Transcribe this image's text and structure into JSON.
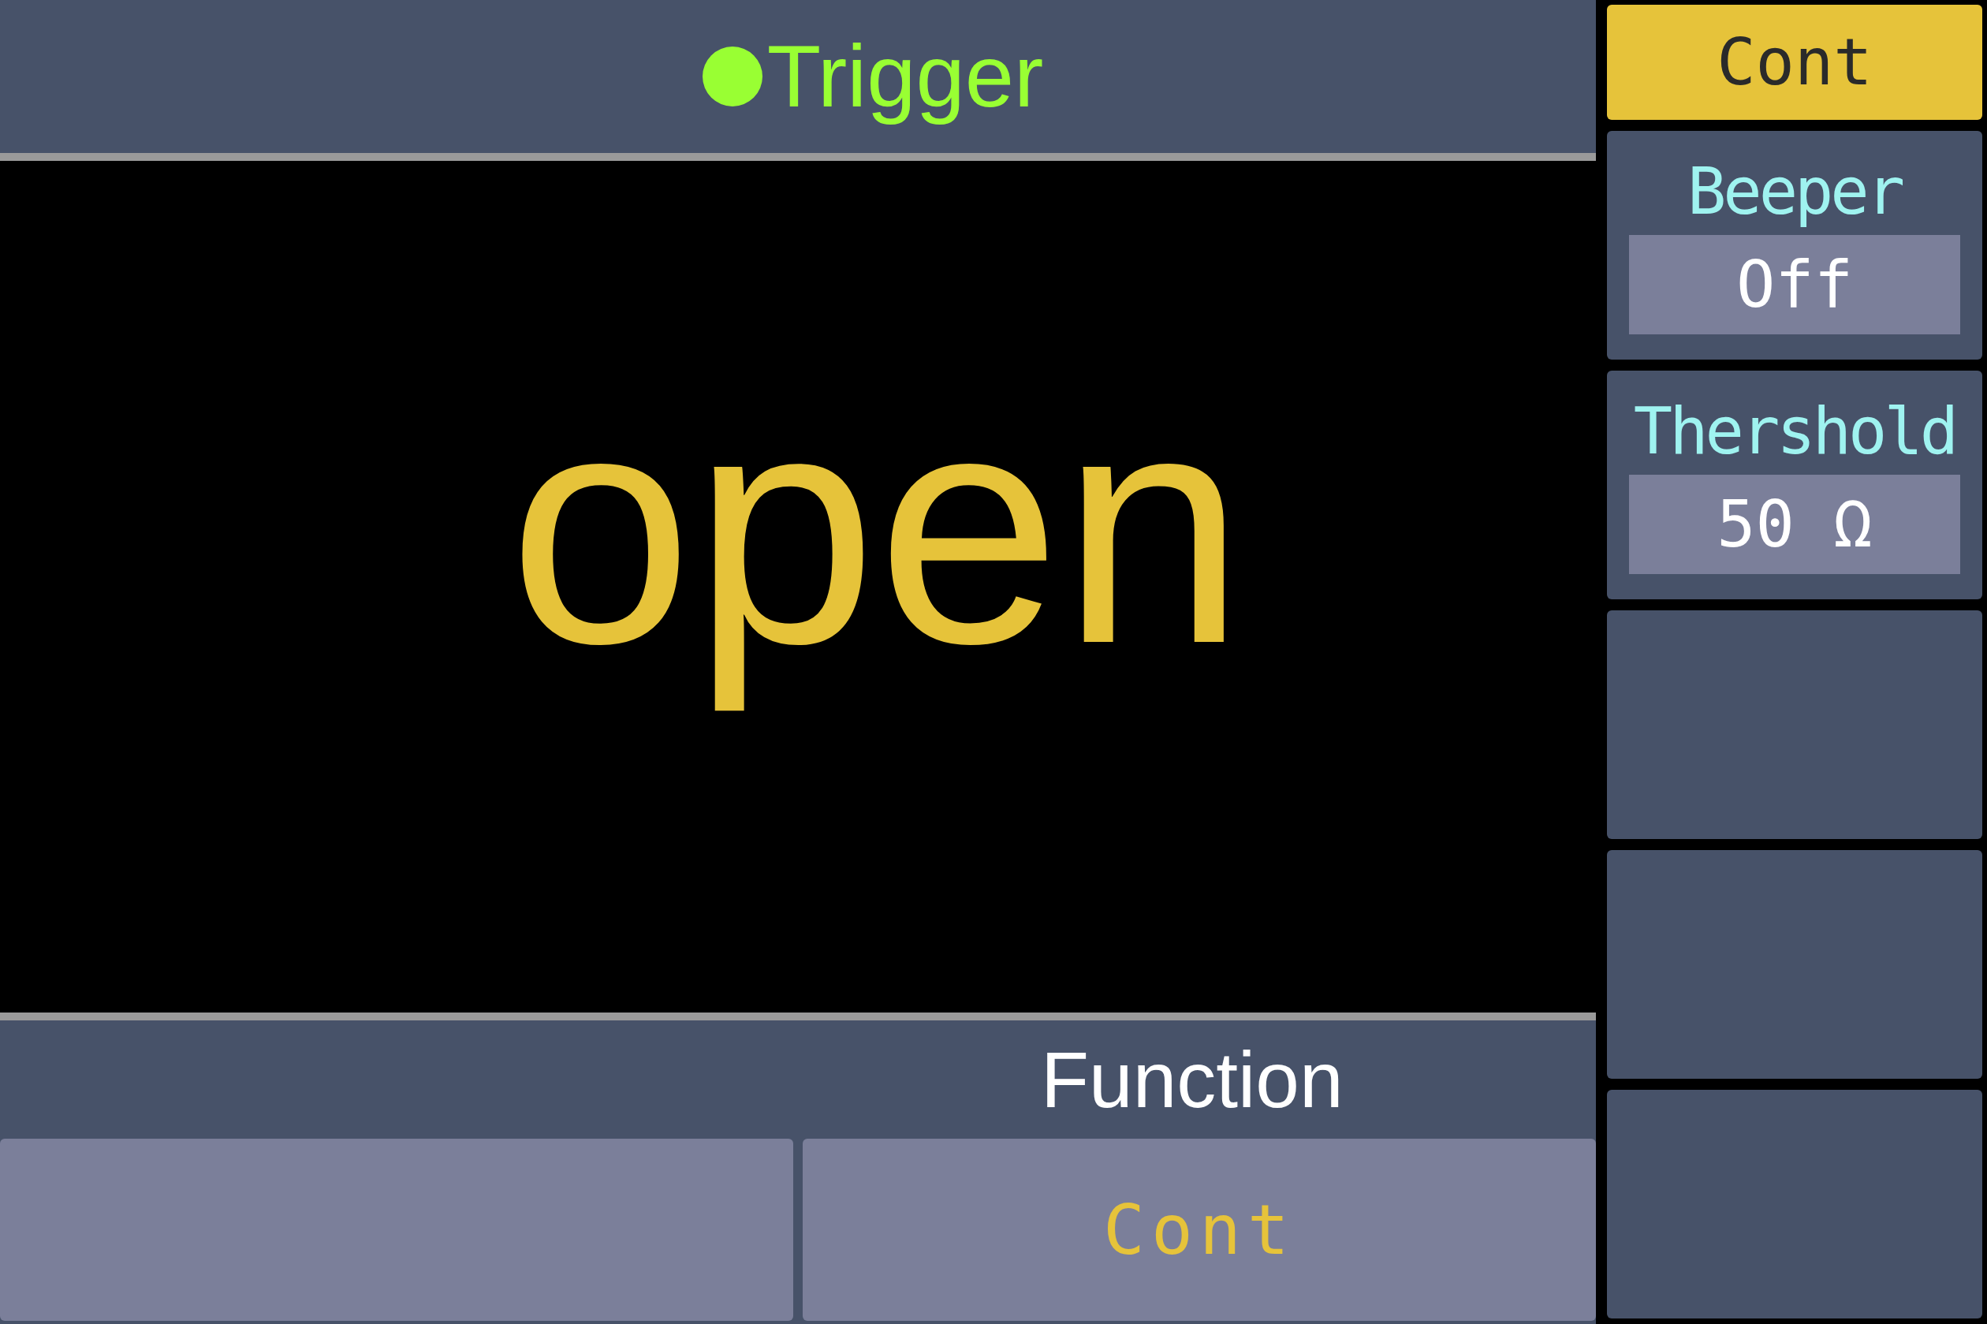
{
  "header": {
    "title": "Trigger"
  },
  "display": {
    "text": "open"
  },
  "function": {
    "label": "Function",
    "slots": [
      {
        "kind": "empty"
      },
      {
        "kind": "value",
        "value": "Cont"
      }
    ]
  },
  "softkeys": [
    {
      "kind": "button",
      "label": "Cont",
      "selected": true
    },
    {
      "kind": "setting",
      "label": "Beeper",
      "value": "Off"
    },
    {
      "kind": "setting",
      "label": "Thershold",
      "value": "50 Ω"
    },
    {
      "kind": "empty"
    },
    {
      "kind": "empty"
    },
    {
      "kind": "empty"
    }
  ]
}
